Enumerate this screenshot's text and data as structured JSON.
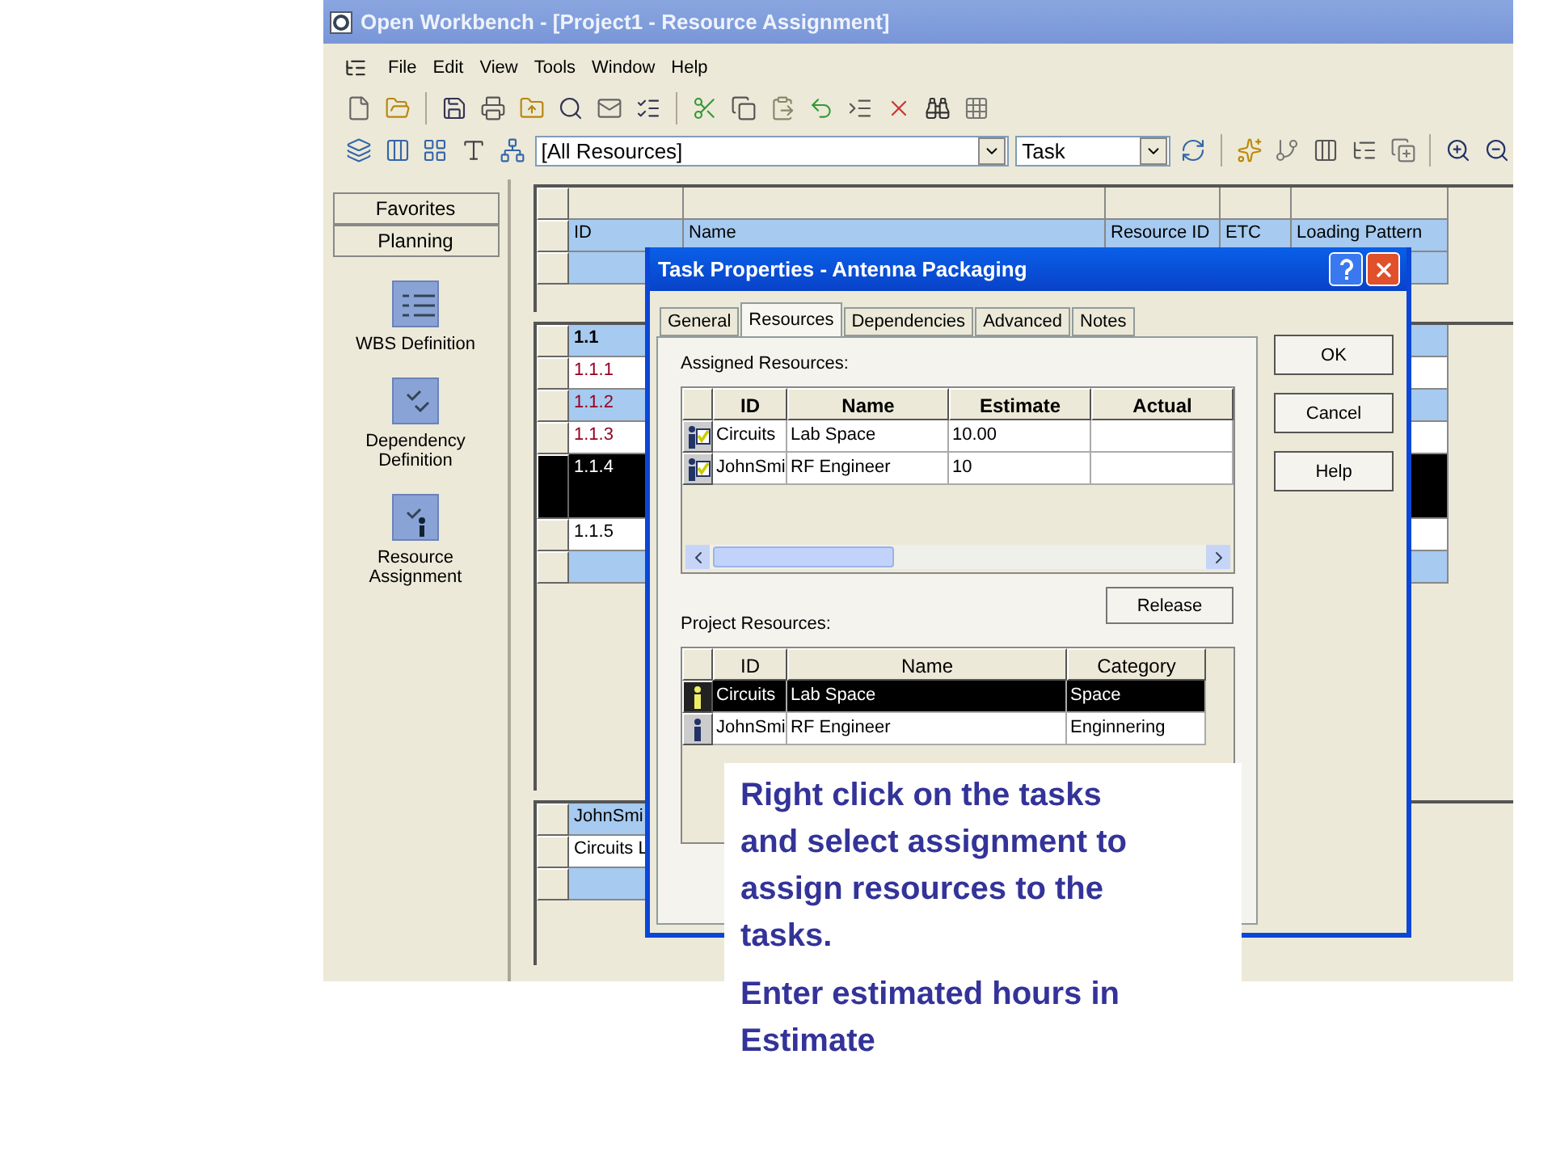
{
  "window": {
    "title": "Open Workbench - [Project1 - Resource Assignment]"
  },
  "menu": [
    "File",
    "Edit",
    "View",
    "Tools",
    "Window",
    "Help"
  ],
  "toolbar": {
    "resource_filter": "[All Resources]",
    "view_select": "Task"
  },
  "sidebar": {
    "groups": [
      {
        "label": "Favorites"
      },
      {
        "label": "Planning"
      }
    ],
    "items": [
      {
        "label": "WBS Definition",
        "kind": "wbs"
      },
      {
        "label": "Dependency Definition",
        "kind": "dependency"
      },
      {
        "label": "Resource Assignment",
        "kind": "resource"
      }
    ]
  },
  "resource_grid": {
    "columns": [
      "ID",
      "Name",
      "Resource ID",
      "ETC",
      "Loading Pattern"
    ]
  },
  "tasks": [
    {
      "id": "1.1",
      "kind": "summary",
      "color": "#000000",
      "selected": false
    },
    {
      "id": "1.1.1",
      "kind": "task",
      "color": "#990022",
      "selected": false
    },
    {
      "id": "1.1.2",
      "kind": "task",
      "color": "#990022",
      "selected": false
    },
    {
      "id": "1.1.3",
      "kind": "task",
      "color": "#990022",
      "selected": false
    },
    {
      "id": "1.1.4",
      "kind": "task",
      "selected": true
    },
    {
      "id": "1.1.5",
      "kind": "task",
      "color": "#000000",
      "selected": false
    }
  ],
  "assignments": [
    {
      "id": "JohnSmi"
    },
    {
      "id": "Circuits L"
    }
  ],
  "dialog": {
    "title": "Task Properties - Antenna Packaging",
    "tabs": [
      {
        "label": "General",
        "selected": false
      },
      {
        "label": "Resources",
        "selected": true
      },
      {
        "label": "Dependencies",
        "selected": false
      },
      {
        "label": "Advanced",
        "selected": false
      },
      {
        "label": "Notes",
        "selected": false
      }
    ],
    "buttons": [
      "OK",
      "Cancel",
      "Help"
    ],
    "assigned_label": "Assigned Resources:",
    "assigned_columns": [
      "ID",
      "Name",
      "Estimate",
      "Actual"
    ],
    "assigned_rows": [
      {
        "id": "Circuits",
        "name": "Lab Space",
        "estimate": "10.00",
        "actual": ""
      },
      {
        "id": "JohnSmi",
        "name": "RF Engineer",
        "estimate": "10",
        "actual": ""
      }
    ],
    "release_button": "Release",
    "project_label": "Project Resources:",
    "project_columns": [
      "ID",
      "Name",
      "Category"
    ],
    "project_rows": [
      {
        "id": "Circuits",
        "name": "Lab Space",
        "category": "Space",
        "selected": true
      },
      {
        "id": "JohnSmi",
        "name": "RF Engineer",
        "category": "Enginnering",
        "selected": false
      }
    ]
  },
  "callout": {
    "paragraphs": [
      "Right click on the tasks and select assignment to assign resources to the tasks.",
      "Enter estimated hours in Estimate"
    ]
  }
}
